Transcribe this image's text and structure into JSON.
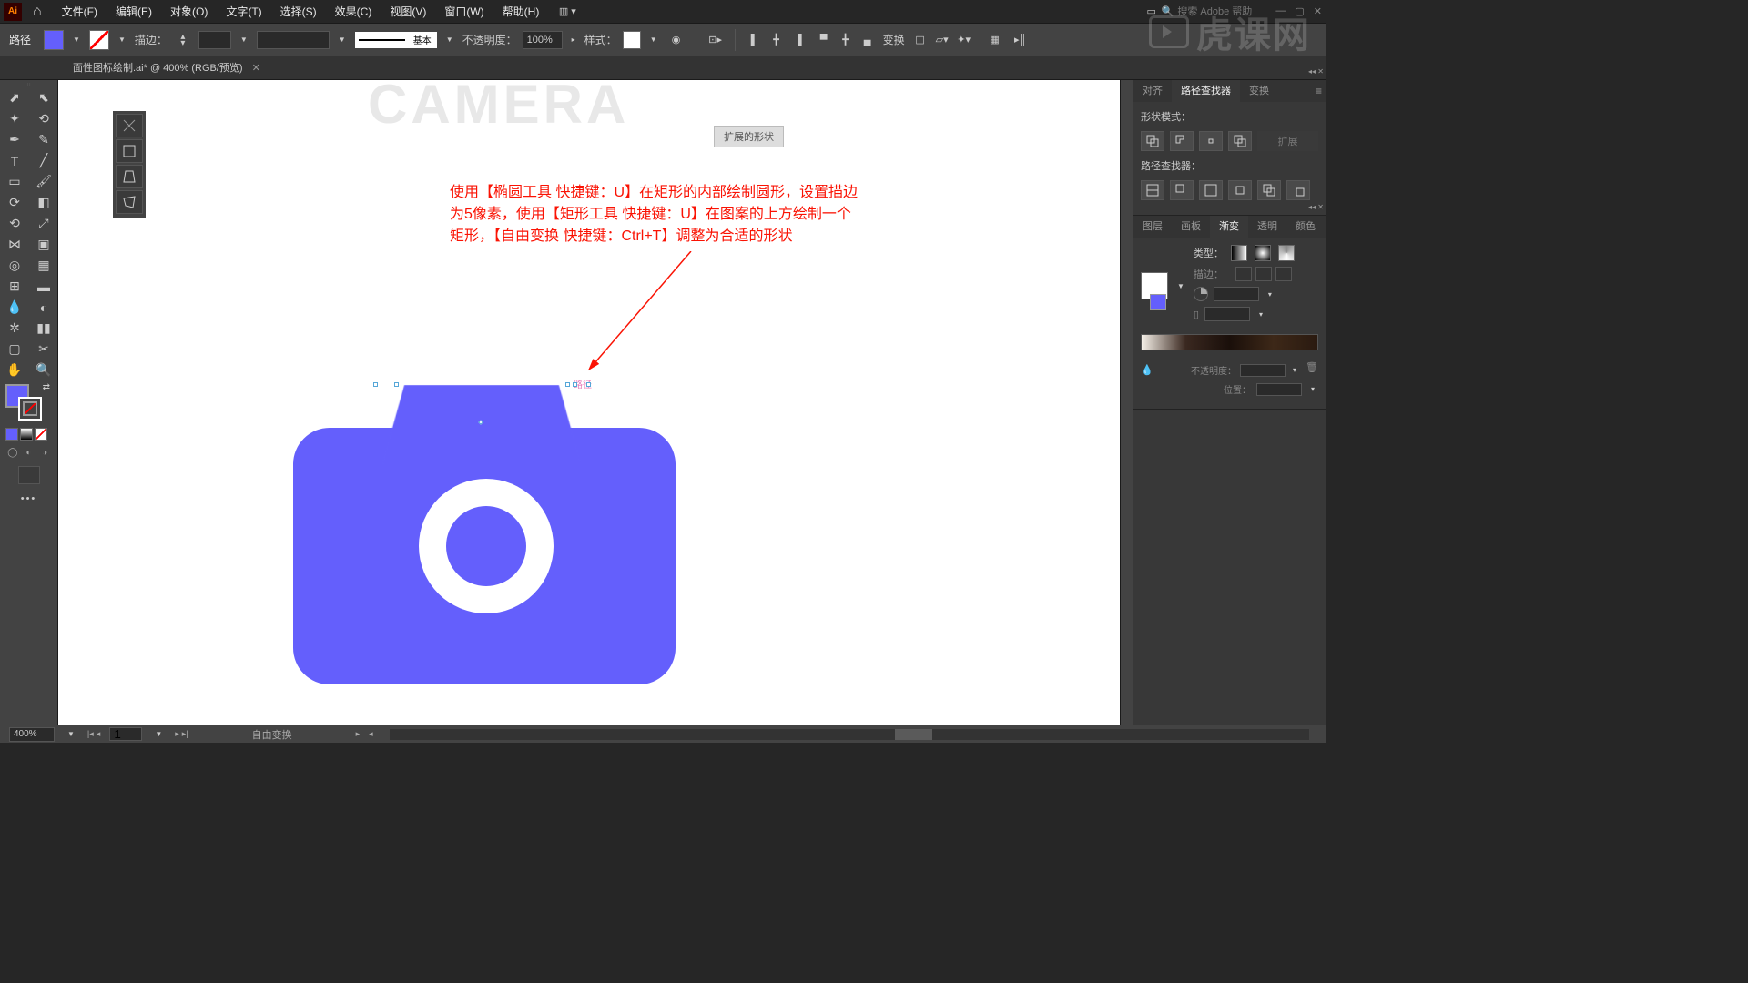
{
  "menubar": {
    "logo": "Ai",
    "items": [
      "文件(F)",
      "编辑(E)",
      "对象(O)",
      "文字(T)",
      "选择(S)",
      "效果(C)",
      "视图(V)",
      "窗口(W)",
      "帮助(H)"
    ],
    "search_placeholder": "搜索 Adobe 帮助"
  },
  "controlbar": {
    "selection_label": "路径",
    "stroke_label": "描边：",
    "stroke_value": "",
    "stroke_style_label": "基本",
    "opacity_label": "不透明度：",
    "opacity_value": "100%",
    "style_label": "样式：",
    "transform_label": "变换"
  },
  "tab": {
    "title": "面性图标绘制.ai* @ 400% (RGB/预览)"
  },
  "canvas": {
    "bg_text": "CAMERA",
    "chip": "扩展的形状",
    "annotation_line1": "使用【椭圆工具 快捷键：U】在矩形的内部绘制圆形，设置描边",
    "annotation_line2": "为5像素，使用【矩形工具 快捷键：U】在图案的上方绘制一个",
    "annotation_line3": "矩形，【自由变换 快捷键：Ctrl+T】调整为合适的形状",
    "path_label": "路径"
  },
  "panels": {
    "pathfinder": {
      "tabs": [
        "对齐",
        "路径查找器",
        "变换"
      ],
      "active_tab": 1,
      "shape_mode_label": "形状模式：",
      "expand_label": "扩展",
      "pathfinder_label": "路径查找器："
    },
    "gradient": {
      "tabs": [
        "图层",
        "画板",
        "渐变",
        "透明",
        "颜色"
      ],
      "active_tab": 2,
      "type_label": "类型：",
      "stroke_label": "描边：",
      "opacity_label": "不透明度：",
      "position_label": "位置："
    }
  },
  "statusbar": {
    "zoom": "400%",
    "artboard": "1",
    "tool_hint": "自由变换"
  },
  "watermark": "虎课网",
  "colors": {
    "camera": "#645ffc",
    "annotation": "#fa1304"
  }
}
